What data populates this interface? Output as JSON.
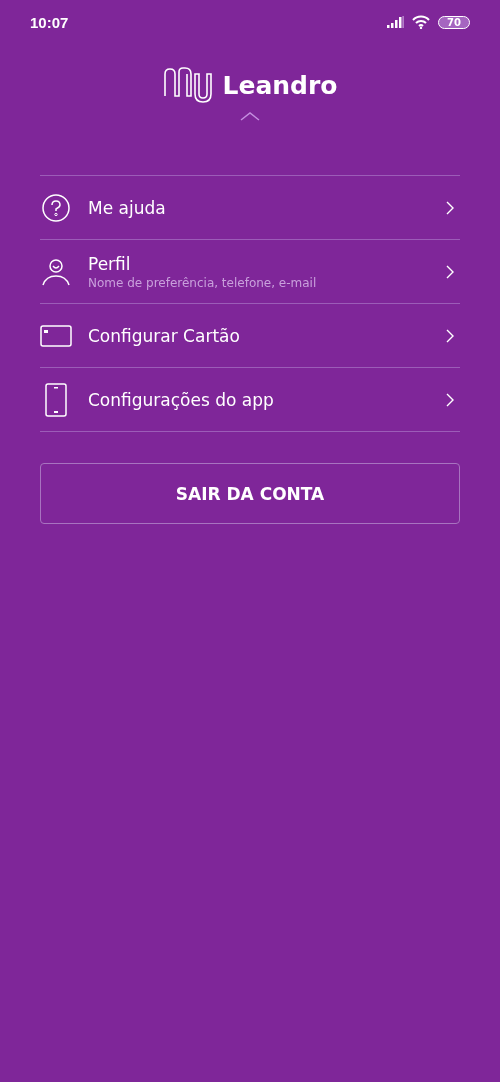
{
  "status_bar": {
    "time": "10:07",
    "battery": "70"
  },
  "header": {
    "name": "Leandro"
  },
  "menu": [
    {
      "kind": "help",
      "label": "Me ajuda"
    },
    {
      "kind": "profile",
      "label": "Perfil",
      "subtitle": "Nome de preferência, telefone, e-mail"
    },
    {
      "kind": "card",
      "label": "Configurar Cartão"
    },
    {
      "kind": "phone",
      "label": "Configurações do app"
    }
  ],
  "logout_button": "SAIR DA CONTA"
}
